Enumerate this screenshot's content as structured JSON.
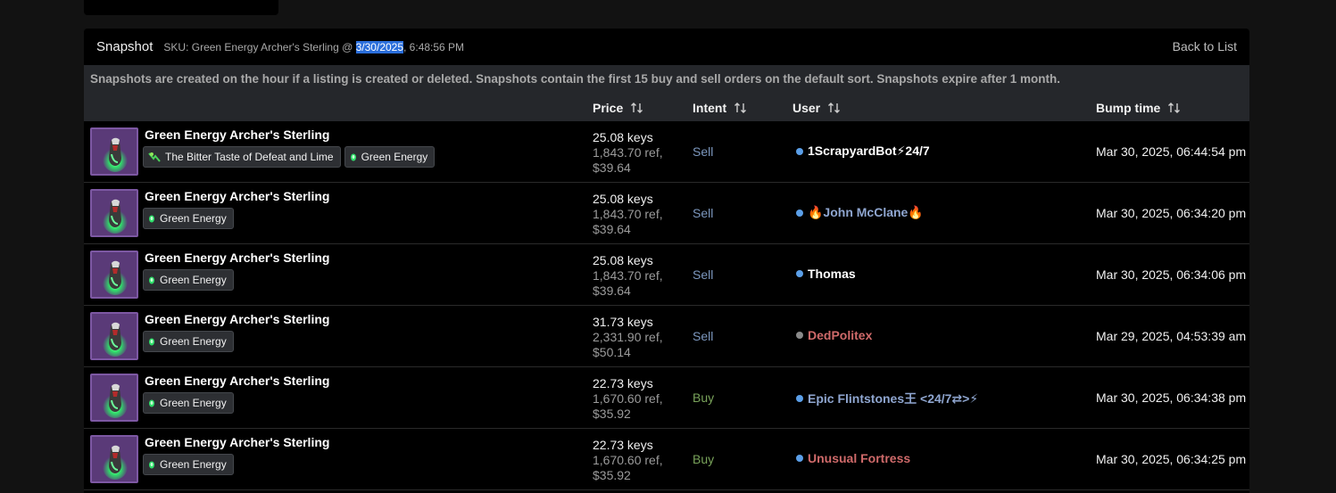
{
  "panel": {
    "title": "Snapshot",
    "sku_prefix": "SKU: Green Energy Archer's Sterling @ ",
    "sku_date": "3/30/2025",
    "sku_time": ", 6:48:56 PM",
    "back_label": "Back to List",
    "notice": "Snapshots are created on the hour if a listing is created or deleted. Snapshots contain the first 15 buy and sell orders on the default sort. Snapshots expire after 1 month."
  },
  "columns": {
    "price": "Price",
    "intent": "Intent",
    "user": "User",
    "bump": "Bump time"
  },
  "colors": {
    "sell": "#7d98bf",
    "buy": "#79a35a",
    "online_dot": "#5b9fe8",
    "offline_dot": "#8a8a8a",
    "item_bg": "#5a3a78"
  },
  "rows": [
    {
      "name": "Green Energy Archer's Sterling",
      "tags": [
        {
          "icon": "sheen-icon",
          "label": "The Bitter Taste of Defeat and Lime"
        },
        {
          "icon": "effect-icon",
          "label": "Green Energy"
        }
      ],
      "price_keys": "25.08 keys",
      "price_ref": "1,843.70 ref,",
      "price_usd": "$39.64",
      "intent": "Sell",
      "user": "1ScrapyardBot⚡24/7",
      "user_color": "#ffffff",
      "dot": "#5b9fe8",
      "bump": "Mar 30, 2025, 06:44:54 pm"
    },
    {
      "name": "Green Energy Archer's Sterling",
      "tags": [
        {
          "icon": "effect-icon",
          "label": "Green Energy"
        }
      ],
      "price_keys": "25.08 keys",
      "price_ref": "1,843.70 ref,",
      "price_usd": "$39.64",
      "intent": "Sell",
      "user": "🔥John McClane🔥",
      "user_color": "#8fa6d0",
      "dot": "#5b9fe8",
      "bump": "Mar 30, 2025, 06:34:20 pm"
    },
    {
      "name": "Green Energy Archer's Sterling",
      "tags": [
        {
          "icon": "effect-icon",
          "label": "Green Energy"
        }
      ],
      "price_keys": "25.08 keys",
      "price_ref": "1,843.70 ref,",
      "price_usd": "$39.64",
      "intent": "Sell",
      "user": "Thomas",
      "user_color": "#ffffff",
      "dot": "#5b9fe8",
      "bump": "Mar 30, 2025, 06:34:06 pm"
    },
    {
      "name": "Green Energy Archer's Sterling",
      "tags": [
        {
          "icon": "effect-icon",
          "label": "Green Energy"
        }
      ],
      "price_keys": "31.73 keys",
      "price_ref": "2,331.90 ref,",
      "price_usd": "$50.14",
      "intent": "Sell",
      "user": "DedPolitex",
      "user_color": "#cf6a6a",
      "dot": "#8a8a8a",
      "bump": "Mar 29, 2025, 04:53:39 am"
    },
    {
      "name": "Green Energy Archer's Sterling",
      "tags": [
        {
          "icon": "effect-icon",
          "label": "Green Energy"
        }
      ],
      "price_keys": "22.73 keys",
      "price_ref": "1,670.60 ref,",
      "price_usd": "$35.92",
      "intent": "Buy",
      "user": "Epic Flintstones王 <24/7⇄>⚡",
      "user_color": "#8fa6d0",
      "dot": "#5b9fe8",
      "bump": "Mar 30, 2025, 06:34:38 pm"
    },
    {
      "name": "Green Energy Archer's Sterling",
      "tags": [
        {
          "icon": "effect-icon",
          "label": "Green Energy"
        }
      ],
      "price_keys": "22.73 keys",
      "price_ref": "1,670.60 ref,",
      "price_usd": "$35.92",
      "intent": "Buy",
      "user": "Unusual Fortress",
      "user_color": "#cf6a6a",
      "dot": "#5b9fe8",
      "bump": "Mar 30, 2025, 06:34:25 pm"
    }
  ]
}
